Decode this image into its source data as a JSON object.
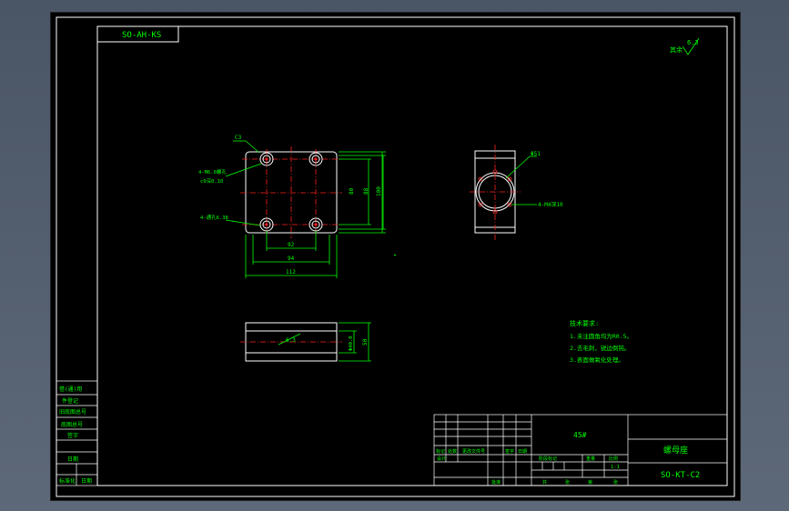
{
  "drawing": {
    "code_box": "SO-AH-KS",
    "roughness_note": "其余",
    "roughness_value": "6.3",
    "dims": {
      "chamfer": "C3",
      "holes_top": "4-M6.0螺孔",
      "holes_depth": "c9深0.10",
      "holes_bottom": "4-通孔6.38",
      "d_92": "92",
      "d_94": "94",
      "d_112": "112",
      "v_80": "80",
      "v_88": "88",
      "v_100": "100",
      "side_dia": "Φ51",
      "side_holes": "4-M4深10",
      "sec_ra": "6.3",
      "sec_h1": "Φ40.0",
      "sec_h2": "50"
    },
    "tech_req": {
      "title": "技术要求:",
      "items": [
        "1.未注圆角均为R0.5。",
        "2.去毛刺，锐边倒钝。",
        "3.表面做氧化处理。"
      ]
    },
    "left_strip": [
      "借(通)用",
      "件登记",
      "旧底图总号",
      "底图总号",
      "签字",
      "日期",
      "标准化",
      "日期"
    ],
    "title_block": {
      "material": "45#",
      "part_name": "螺母座",
      "drawing_no": "SO-KT-C2",
      "scale": "1:1",
      "labels_row1": [
        "标记",
        "处数",
        "更改文件号",
        "签字",
        "日期"
      ],
      "labels_row2": [
        "设计",
        "",
        "",
        "",
        ""
      ],
      "labels_small": [
        "阶段标记",
        "重量",
        "比例"
      ],
      "sheet_labels": [
        "共",
        "张",
        "第",
        "张"
      ],
      "approve": "批准"
    }
  }
}
